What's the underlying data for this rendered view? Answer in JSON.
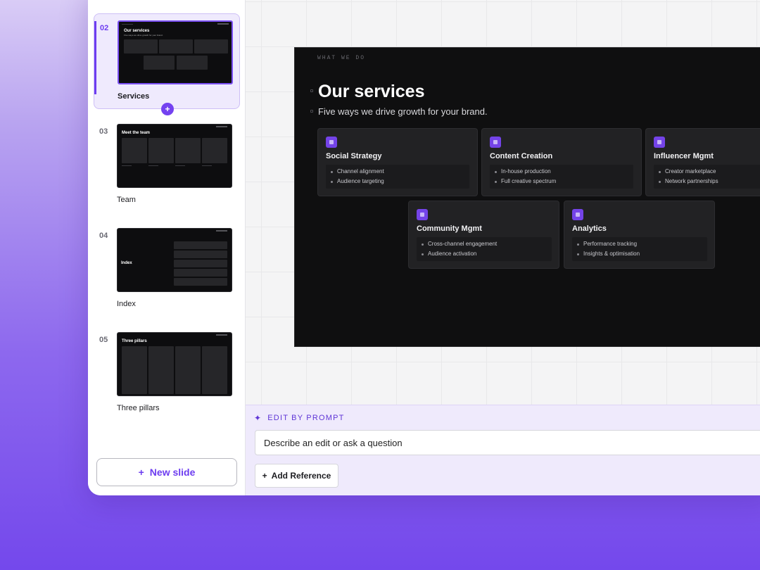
{
  "slides": [
    {
      "num": "02",
      "label": "Services"
    },
    {
      "num": "03",
      "label": "Team"
    },
    {
      "num": "04",
      "label": "Index"
    },
    {
      "num": "05",
      "label": "Three pillars"
    }
  ],
  "sidebar": {
    "add_slide_glyph": "+",
    "new_slide_plus": "+",
    "new_slide_label": "New slide"
  },
  "thumbs": {
    "services": {
      "title": "Our services",
      "subtitle": "Five ways we drive growth for your brand."
    },
    "team": {
      "title": "Meet the team"
    },
    "index": {
      "title": "Index"
    },
    "pillars": {
      "title": "Three pillars"
    }
  },
  "slide": {
    "eyebrow": "WHAT WE DO",
    "title": "Our services",
    "subtitle": "Five ways we drive growth for your brand.",
    "cards": [
      {
        "title": "Social Strategy",
        "items": [
          "Channel alignment",
          "Audience targeting"
        ]
      },
      {
        "title": "Content Creation",
        "items": [
          "In-house production",
          "Full creative spectrum"
        ]
      },
      {
        "title": "Influencer Mgmt",
        "items": [
          "Creator marketplace",
          "Network partnerships"
        ]
      },
      {
        "title": "Community Mgmt",
        "items": [
          "Cross-channel engagement",
          "Audience activation"
        ]
      },
      {
        "title": "Analytics",
        "items": [
          "Performance tracking",
          "Insights & optimisation"
        ]
      }
    ]
  },
  "prompt": {
    "label": "EDIT BY PROMPT",
    "spark_icon": "sparkle-icon",
    "placeholder": "Describe an edit or ask a question",
    "ref_plus": "+",
    "add_reference": "Add Reference"
  },
  "colors": {
    "accent": "#6d3df0",
    "slide_bg": "#0f0f10",
    "card_bg": "#222224"
  }
}
